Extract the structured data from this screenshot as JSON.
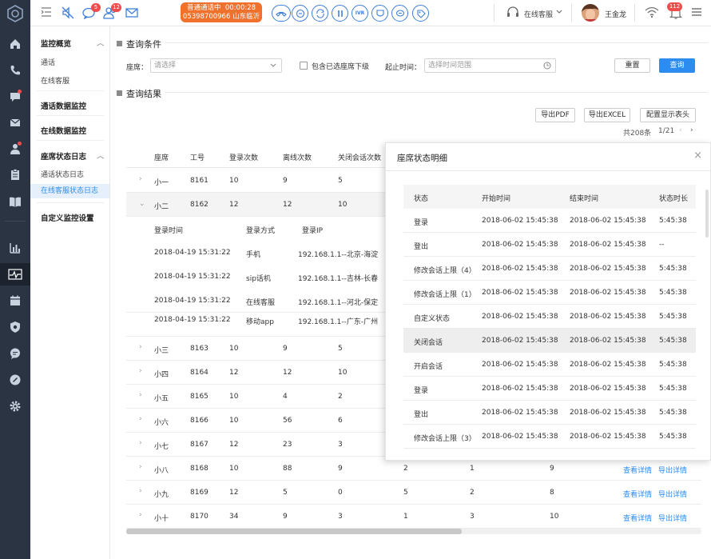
{
  "topbar": {
    "call_status": "普通通话中",
    "call_time": "00:00:28",
    "call_number": "05398700966",
    "call_location": "山东临沂",
    "badges": {
      "chat": "5",
      "users": "12"
    },
    "status_label": "在线客服",
    "user_name": "王金龙",
    "notify_count": "112",
    "ivr_label": "IVR"
  },
  "sidebar": {
    "groups": [
      {
        "title": "监控概览",
        "items": [
          "通话",
          "在线客服"
        ]
      },
      {
        "title": "通话数据监控",
        "items": []
      },
      {
        "title": "在线数据监控",
        "items": []
      },
      {
        "title": "座席状态日志",
        "items": [
          "通话状态日志",
          "在线客服状态日志"
        ]
      },
      {
        "title": "自定义监控设置",
        "items": []
      }
    ],
    "selected": "在线客服状态日志"
  },
  "query": {
    "section_title": "查询条件",
    "agent_label": "座席：",
    "agent_placeholder": "请选择",
    "include_sub_label": "包含已选座席下级",
    "time_label": "起止时间：",
    "time_placeholder": "选择时间范围",
    "reset_label": "重置",
    "search_label": "查询"
  },
  "results": {
    "section_title": "查询结果",
    "export_pdf": "导出PDF",
    "export_excel": "导出EXCEL",
    "config_header": "配置显示表头",
    "total": "共208条",
    "page": "1/21",
    "columns": [
      "座席",
      "工号",
      "登录次数",
      "离线次数",
      "关闭会话次数"
    ],
    "rows": [
      {
        "name": "小一",
        "id": "8161",
        "login": "10",
        "offline": "9",
        "close": "5"
      },
      {
        "name": "小二",
        "id": "8162",
        "login": "12",
        "offline": "12",
        "close": "10"
      },
      {
        "name": "小三",
        "id": "8163",
        "login": "10",
        "offline": "9",
        "close": "5"
      },
      {
        "name": "小四",
        "id": "8164",
        "login": "12",
        "offline": "12",
        "close": "10"
      },
      {
        "name": "小五",
        "id": "8165",
        "login": "10",
        "offline": "4",
        "close": "2"
      },
      {
        "name": "小六",
        "id": "8166",
        "login": "10",
        "offline": "56",
        "close": "6"
      },
      {
        "name": "小七",
        "id": "8167",
        "login": "12",
        "offline": "23",
        "close": "3"
      },
      {
        "name": "小八",
        "id": "8168",
        "login": "10",
        "offline": "88",
        "close": "9",
        "c6": "2",
        "c7": "1",
        "c8": "9"
      },
      {
        "name": "小九",
        "id": "8169",
        "login": "12",
        "offline": "5",
        "close": "0",
        "c6": "5",
        "c7": "2",
        "c8": "8"
      },
      {
        "name": "小十",
        "id": "8170",
        "login": "34",
        "offline": "9",
        "close": "3",
        "c6": "1",
        "c7": "3",
        "c8": "10"
      }
    ],
    "view_detail": "查看详情",
    "export_detail": "导出详情",
    "expanded": {
      "columns": [
        "登录时间",
        "登录方式",
        "登录IP"
      ],
      "rows": [
        {
          "time": "2018-04-19 15:31:22",
          "method": "手机",
          "ip": "192.168.1.1--北京-海淀"
        },
        {
          "time": "2018-04-19 15:31:22",
          "method": "sip话机",
          "ip": "192.168.1.1--吉林-长春"
        },
        {
          "time": "2018-04-19 15:31:22",
          "method": "在线客服",
          "ip": "192.168.1.1--河北-保定"
        },
        {
          "time": "2018-04-19 15:31:22",
          "method": "移动app",
          "ip": "192.168.1.1--广东-广州"
        }
      ]
    }
  },
  "panel": {
    "title": "座席状态明细",
    "columns": [
      "状态",
      "开始时间",
      "结束时间",
      "状态时长"
    ],
    "rows": [
      {
        "status": "登录",
        "start": "2018-06-02 15:45:38",
        "end": "2018-06-02 15:45:38",
        "dur": "5:45:38"
      },
      {
        "status": "登出",
        "start": "2018-06-02 15:45:38",
        "end": "2018-06-02 15:45:38",
        "dur": "--"
      },
      {
        "status": "修改会话上限（4）",
        "start": "2018-06-02 15:45:38",
        "end": "2018-06-02 15:45:38",
        "dur": "5:45:38"
      },
      {
        "status": "修改会话上限（1）",
        "start": "2018-06-02 15:45:38",
        "end": "2018-06-02 15:45:38",
        "dur": "5:45:38"
      },
      {
        "status": "自定义状态",
        "start": "2018-06-02 15:45:38",
        "end": "2018-06-02 15:45:38",
        "dur": "5:45:38"
      },
      {
        "status": "关闭会话",
        "start": "2018-06-02 15:45:38",
        "end": "2018-06-02 15:45:38",
        "dur": "5:45:38"
      },
      {
        "status": "开启会话",
        "start": "2018-06-02 15:45:38",
        "end": "2018-06-02 15:45:38",
        "dur": "5:45:38"
      },
      {
        "status": "登录",
        "start": "2018-06-02 15:45:38",
        "end": "2018-06-02 15:45:38",
        "dur": "5:45:38"
      },
      {
        "status": "登出",
        "start": "2018-06-02 15:45:38",
        "end": "2018-06-02 15:45:38",
        "dur": "5:45:38"
      },
      {
        "status": "修改会话上限（3）",
        "start": "2018-06-02 15:45:38",
        "end": "2018-06-02 15:45:38",
        "dur": "5:45:38"
      }
    ],
    "close": "×"
  },
  "colors": {
    "accent": "#2d8cf0",
    "nav_bg": "#2a3443",
    "call_orange": "#f0712c",
    "badge_red": "#f04c4c"
  }
}
